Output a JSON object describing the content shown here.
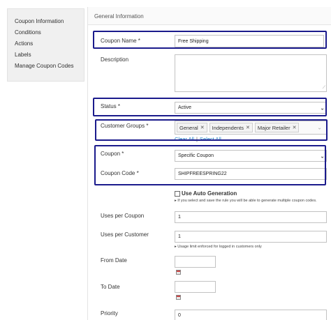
{
  "sidebar": {
    "items": [
      {
        "label": "Coupon Information"
      },
      {
        "label": "Conditions"
      },
      {
        "label": "Actions"
      },
      {
        "label": "Labels"
      },
      {
        "label": "Manage Coupon Codes"
      }
    ]
  },
  "panel": {
    "title": "General Information"
  },
  "form": {
    "coupon_name": {
      "label": "Coupon Name *",
      "value": "Free Shipping"
    },
    "description": {
      "label": "Description",
      "value": ""
    },
    "status": {
      "label": "Status *",
      "value": "Active"
    },
    "customer_groups": {
      "label": "Customer Groups *",
      "chips": [
        "General",
        "Independents",
        "Major Retailer"
      ],
      "clear_all": "Clear All",
      "separator": "|",
      "select_all": "Select All"
    },
    "coupon": {
      "label": "Coupon *",
      "value": "Specific Coupon"
    },
    "coupon_code": {
      "label": "Coupon Code *",
      "value": "SHIPFREESPRING22"
    },
    "auto_generation": {
      "label": "Use Auto Generation",
      "checked": false,
      "note": "If you select and save the rule you will be able to generate multiple coupon codes."
    },
    "uses_per_coupon": {
      "label": "Uses per Coupon",
      "value": "1"
    },
    "uses_per_customer": {
      "label": "Uses per Customer",
      "value": "1",
      "note": "Usage limit enforced for logged in customers only"
    },
    "from_date": {
      "label": "From Date",
      "value": ""
    },
    "to_date": {
      "label": "To Date",
      "value": ""
    },
    "priority": {
      "label": "Priority",
      "value": "0"
    }
  },
  "colors": {
    "highlight": "#1a1a8c",
    "link": "#1979c3",
    "sidebar_bg": "#f0f0f0"
  },
  "icons": {
    "calendar": "calendar-icon",
    "dropdown": "chevron-down-icon",
    "remove": "close-icon",
    "info": "info-icon"
  }
}
